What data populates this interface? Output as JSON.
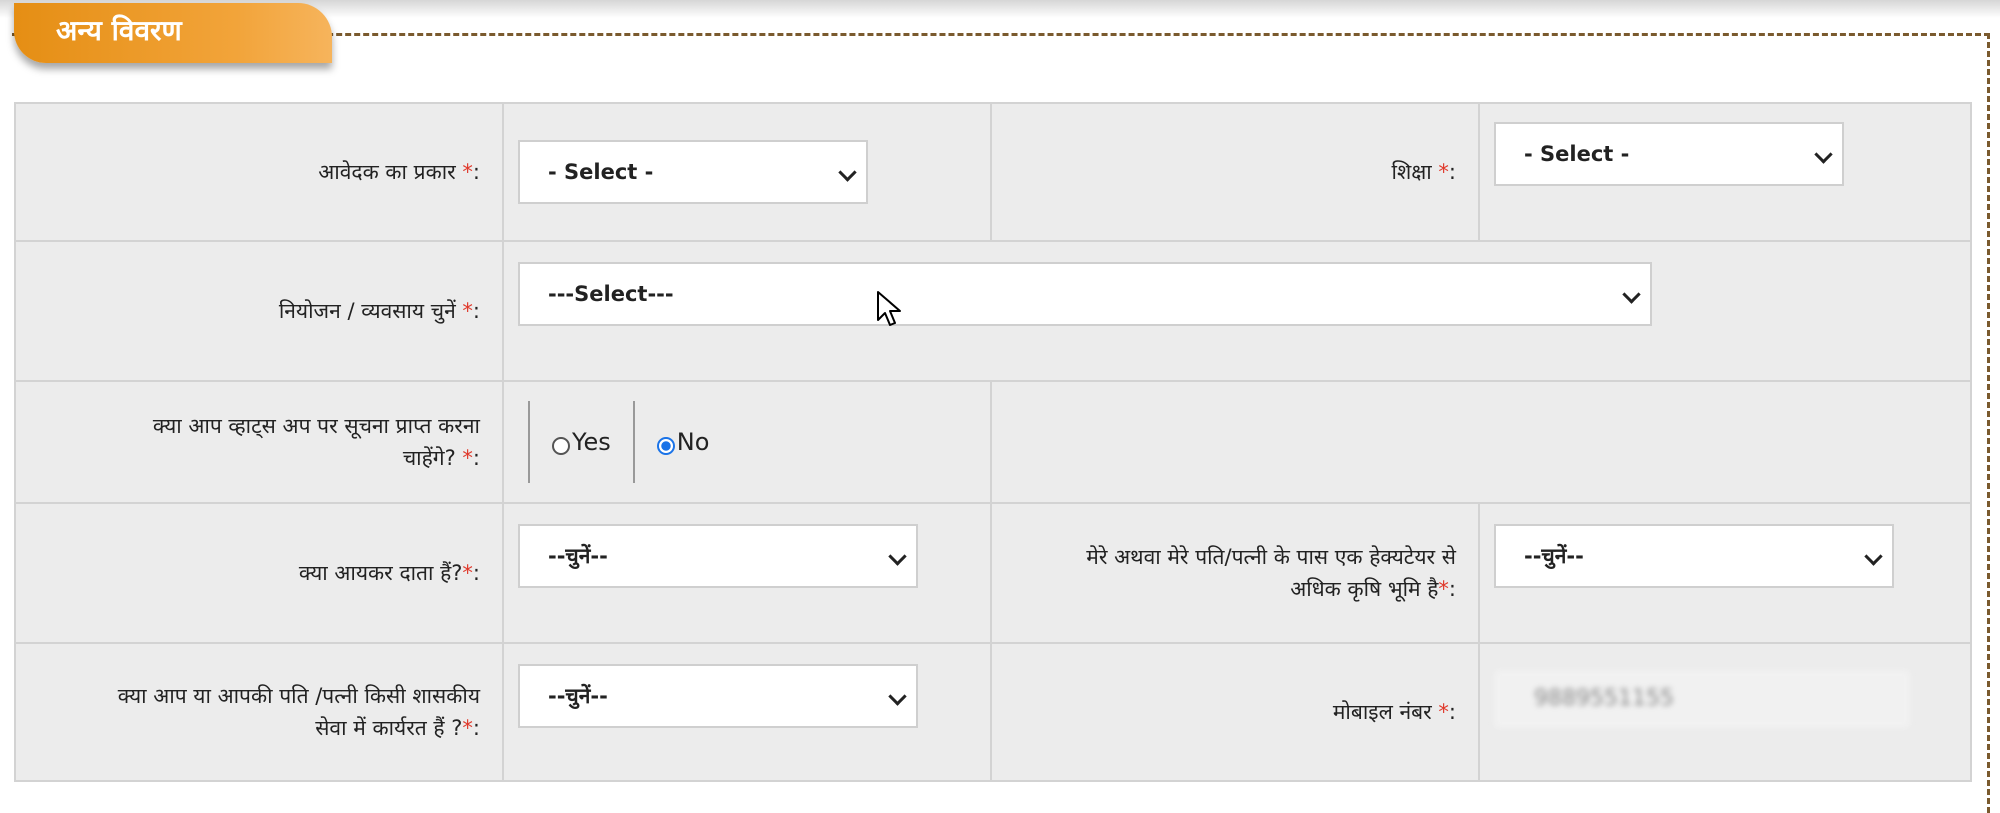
{
  "section": {
    "title": "अन्य विवरण"
  },
  "fields": {
    "applicant_type": {
      "label": "आवेदक का प्रकार",
      "value": "- Select -"
    },
    "education": {
      "label": "शिक्षा",
      "value": "- Select -"
    },
    "occupation": {
      "label": "नियोजन / व्यवसाय चुनें",
      "value": "---Select---"
    },
    "whatsapp": {
      "label_line1": "क्या आप व्हाट्स अप पर सूचना प्राप्त करना",
      "label_line2": "चाहेंगे?",
      "options": [
        "Yes",
        "No"
      ],
      "selected": "No"
    },
    "income_tax": {
      "label": "क्या आयकर दाता हैं?",
      "value": "--चुनें--"
    },
    "land": {
      "label_line1": "मेरे अथवा मेरे पति/पत्नी के पास एक हेक्यटेयर से",
      "label_line2": "अधिक कृषि भूमि है",
      "value": "--चुनें--"
    },
    "govt_service": {
      "label_line1": "क्या आप या आपकी पति /पत्नी किसी शासकीय",
      "label_line2": "सेवा में कार्यरत हैं ?",
      "value": "--चुनें--"
    },
    "mobile": {
      "label": "मोबाइल नंबर",
      "value": "9889551155"
    }
  },
  "required_mark": "*",
  "label_suffix": ":",
  "icons": {
    "chevron": "chevron-down-icon",
    "cursor": "mouse-pointer-icon"
  },
  "colors": {
    "tab": "#e58e14",
    "required": "#e0392b",
    "radio_on": "#1a73e8"
  }
}
